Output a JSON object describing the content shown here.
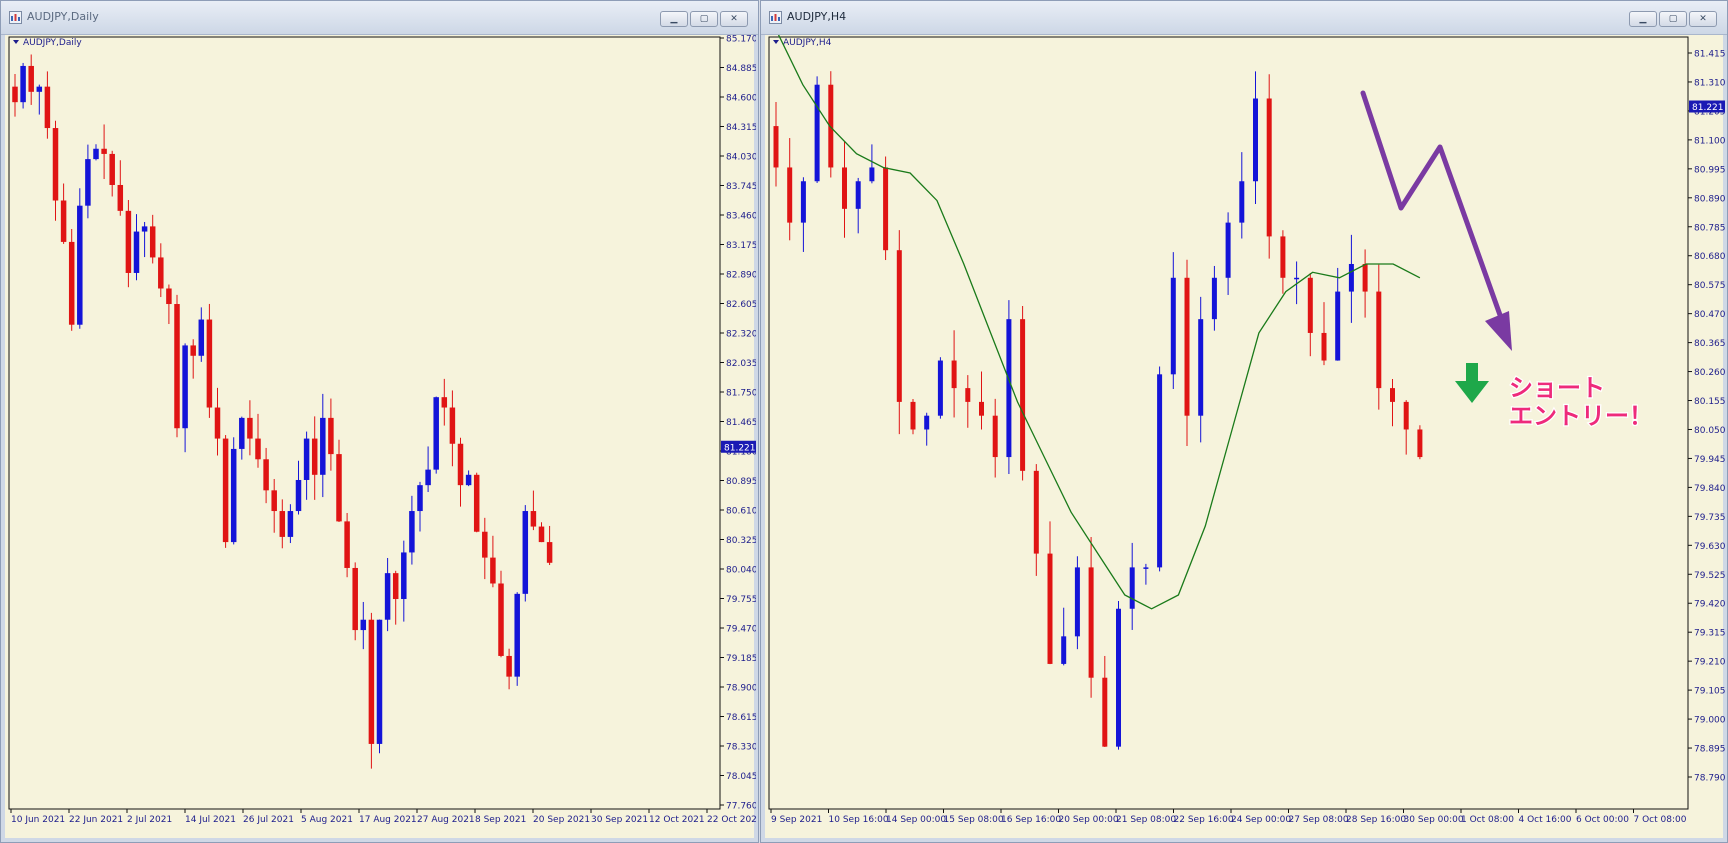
{
  "windows": [
    {
      "title": "AUDJPY,Daily",
      "chart_label": "AUDJPY,Daily",
      "price_tag": "81.221",
      "y_ticks": [
        "85.170",
        "84.885",
        "84.600",
        "84.315",
        "84.030",
        "83.745",
        "83.460",
        "83.175",
        "82.890",
        "82.605",
        "82.320",
        "82.035",
        "81.750",
        "81.465",
        "81.180",
        "80.895",
        "80.610",
        "80.325",
        "80.040",
        "79.755",
        "79.470",
        "79.185",
        "78.900",
        "78.615",
        "78.330",
        "78.045",
        "77.760"
      ],
      "x_ticks": [
        "10 Jun 2021",
        "22 Jun 2021",
        "2 Jul 2021",
        "14 Jul 2021",
        "26 Jul 2021",
        "5 Aug 2021",
        "17 Aug 2021",
        "27 Aug 2021",
        "8 Sep 2021",
        "20 Sep 2021",
        "30 Sep 2021",
        "12 Oct 2021",
        "22 Oct 2021"
      ]
    },
    {
      "title": "AUDJPY,H4",
      "chart_label": "AUDJPY,H4",
      "price_tag": "81.221",
      "y_ticks": [
        "81.415",
        "81.310",
        "81.205",
        "81.100",
        "80.995",
        "80.890",
        "80.785",
        "80.680",
        "80.575",
        "80.470",
        "80.365",
        "80.260",
        "80.155",
        "80.050",
        "79.945",
        "79.840",
        "79.735",
        "79.630",
        "79.525",
        "79.420",
        "79.315",
        "79.210",
        "79.105",
        "79.000",
        "78.895",
        "78.790"
      ],
      "x_ticks": [
        "9 Sep 2021",
        "10 Sep 16:00",
        "14 Sep 00:00",
        "15 Sep 08:00",
        "16 Sep 16:00",
        "20 Sep 00:00",
        "21 Sep 08:00",
        "22 Sep 16:00",
        "24 Sep 00:00",
        "27 Sep 08:00",
        "28 Sep 16:00",
        "30 Sep 00:00",
        "1 Oct 08:00",
        "4 Oct 16:00",
        "6 Oct 00:00",
        "7 Oct 08:00"
      ],
      "annotation": {
        "line1": "ショート",
        "line2": "エントリー！"
      }
    }
  ],
  "colors": {
    "bull": "#1414d8",
    "bear": "#e01414",
    "ma": "#1a7a1a",
    "arrow": "#7a3aa2",
    "down_arrow": "#1ea84a",
    "annotation": "#ee2a7b",
    "tag_bg": "#1a1ab4",
    "chart_bg": "#f6f3dc",
    "axis_text": "#1d1d8c"
  },
  "chart_data": [
    {
      "type": "candlestick",
      "title": "AUDJPY,Daily",
      "ylim": [
        77.76,
        85.17
      ],
      "x_labels": [
        "10 Jun 2021",
        "22 Jun 2021",
        "2 Jul 2021",
        "14 Jul 2021",
        "26 Jul 2021",
        "5 Aug 2021",
        "17 Aug 2021",
        "27 Aug 2021",
        "8 Sep 2021",
        "20 Sep 2021",
        "30 Sep 2021",
        "12 Oct 2021",
        "22 Oct 2021"
      ],
      "closes": [
        84.55,
        84.9,
        84.65,
        84.7,
        84.3,
        83.6,
        83.2,
        82.4,
        83.55,
        84.0,
        84.1,
        84.05,
        83.75,
        83.5,
        82.9,
        83.3,
        83.35,
        83.05,
        82.75,
        82.6,
        81.4,
        82.2,
        82.1,
        82.45,
        81.6,
        81.3,
        80.3,
        81.2,
        81.5,
        81.3,
        81.1,
        80.8,
        80.6,
        80.35,
        80.6,
        80.9,
        81.3,
        80.95,
        81.5,
        81.15,
        80.5,
        80.05,
        79.45,
        79.55,
        78.35,
        79.55,
        80.0,
        79.75,
        80.2,
        80.6,
        80.85,
        81.0,
        81.7,
        81.6,
        81.25,
        80.85,
        80.95,
        80.4,
        80.15,
        79.9,
        79.2,
        79.0,
        79.8,
        80.6,
        80.45,
        80.3,
        80.1
      ]
    },
    {
      "type": "candlestick",
      "title": "AUDJPY,H4",
      "ylim": [
        78.79,
        81.415
      ],
      "x_labels": [
        "9 Sep 2021",
        "10 Sep 16:00",
        "14 Sep 00:00",
        "15 Sep 08:00",
        "16 Sep 16:00",
        "20 Sep 00:00",
        "21 Sep 08:00",
        "22 Sep 16:00",
        "24 Sep 00:00",
        "27 Sep 08:00",
        "28 Sep 16:00",
        "30 Sep 00:00",
        "1 Oct 08:00",
        "4 Oct 16:00",
        "6 Oct 00:00",
        "7 Oct 08:00"
      ],
      "closes": [
        81.0,
        80.8,
        80.95,
        81.3,
        81.0,
        80.85,
        80.95,
        81.0,
        80.7,
        80.15,
        80.05,
        80.1,
        80.3,
        80.2,
        80.15,
        80.1,
        79.95,
        80.45,
        79.9,
        79.6,
        79.2,
        79.3,
        79.55,
        79.15,
        78.9,
        79.4,
        79.55,
        79.55,
        80.25,
        80.6,
        80.1,
        80.45,
        80.6,
        80.8,
        80.95,
        81.25,
        80.75,
        80.6,
        80.6,
        80.4,
        80.3,
        80.55,
        80.65,
        80.55,
        80.2,
        80.15,
        80.05,
        79.95
      ],
      "moving_average": [
        81.5,
        81.3,
        81.15,
        81.05,
        81.0,
        80.98,
        80.88,
        80.65,
        80.4,
        80.15,
        79.95,
        79.75,
        79.6,
        79.45,
        79.4,
        79.45,
        79.7,
        80.05,
        80.4,
        80.55,
        80.62,
        80.6,
        80.65,
        80.65,
        80.6
      ]
    }
  ]
}
